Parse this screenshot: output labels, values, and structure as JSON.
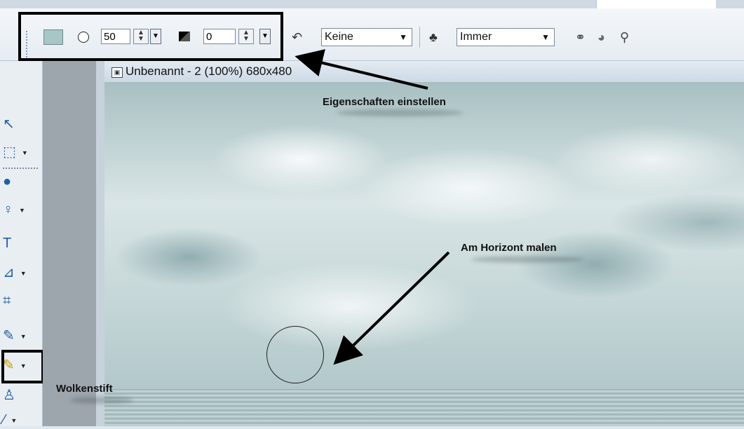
{
  "toolbar": {
    "size_value": "50",
    "opacity_value": "0",
    "mode_select": "Keine",
    "apply_select": "Immer"
  },
  "window": {
    "title": "Unbenannt - 2 (100%) 680x480"
  },
  "annotations": {
    "properties_label": "Eigenschaften einstellen",
    "horizon_label": "Am Horizont malen",
    "tool_label": "Wolkenstift"
  },
  "colors": {
    "swatch": "#a9c6c6",
    "highlight": "#000000"
  },
  "icons": [
    "color-swatch-icon",
    "brush-shape-icon",
    "opacity-icon",
    "undo-icon",
    "blend-icon",
    "tool-options-icons"
  ]
}
